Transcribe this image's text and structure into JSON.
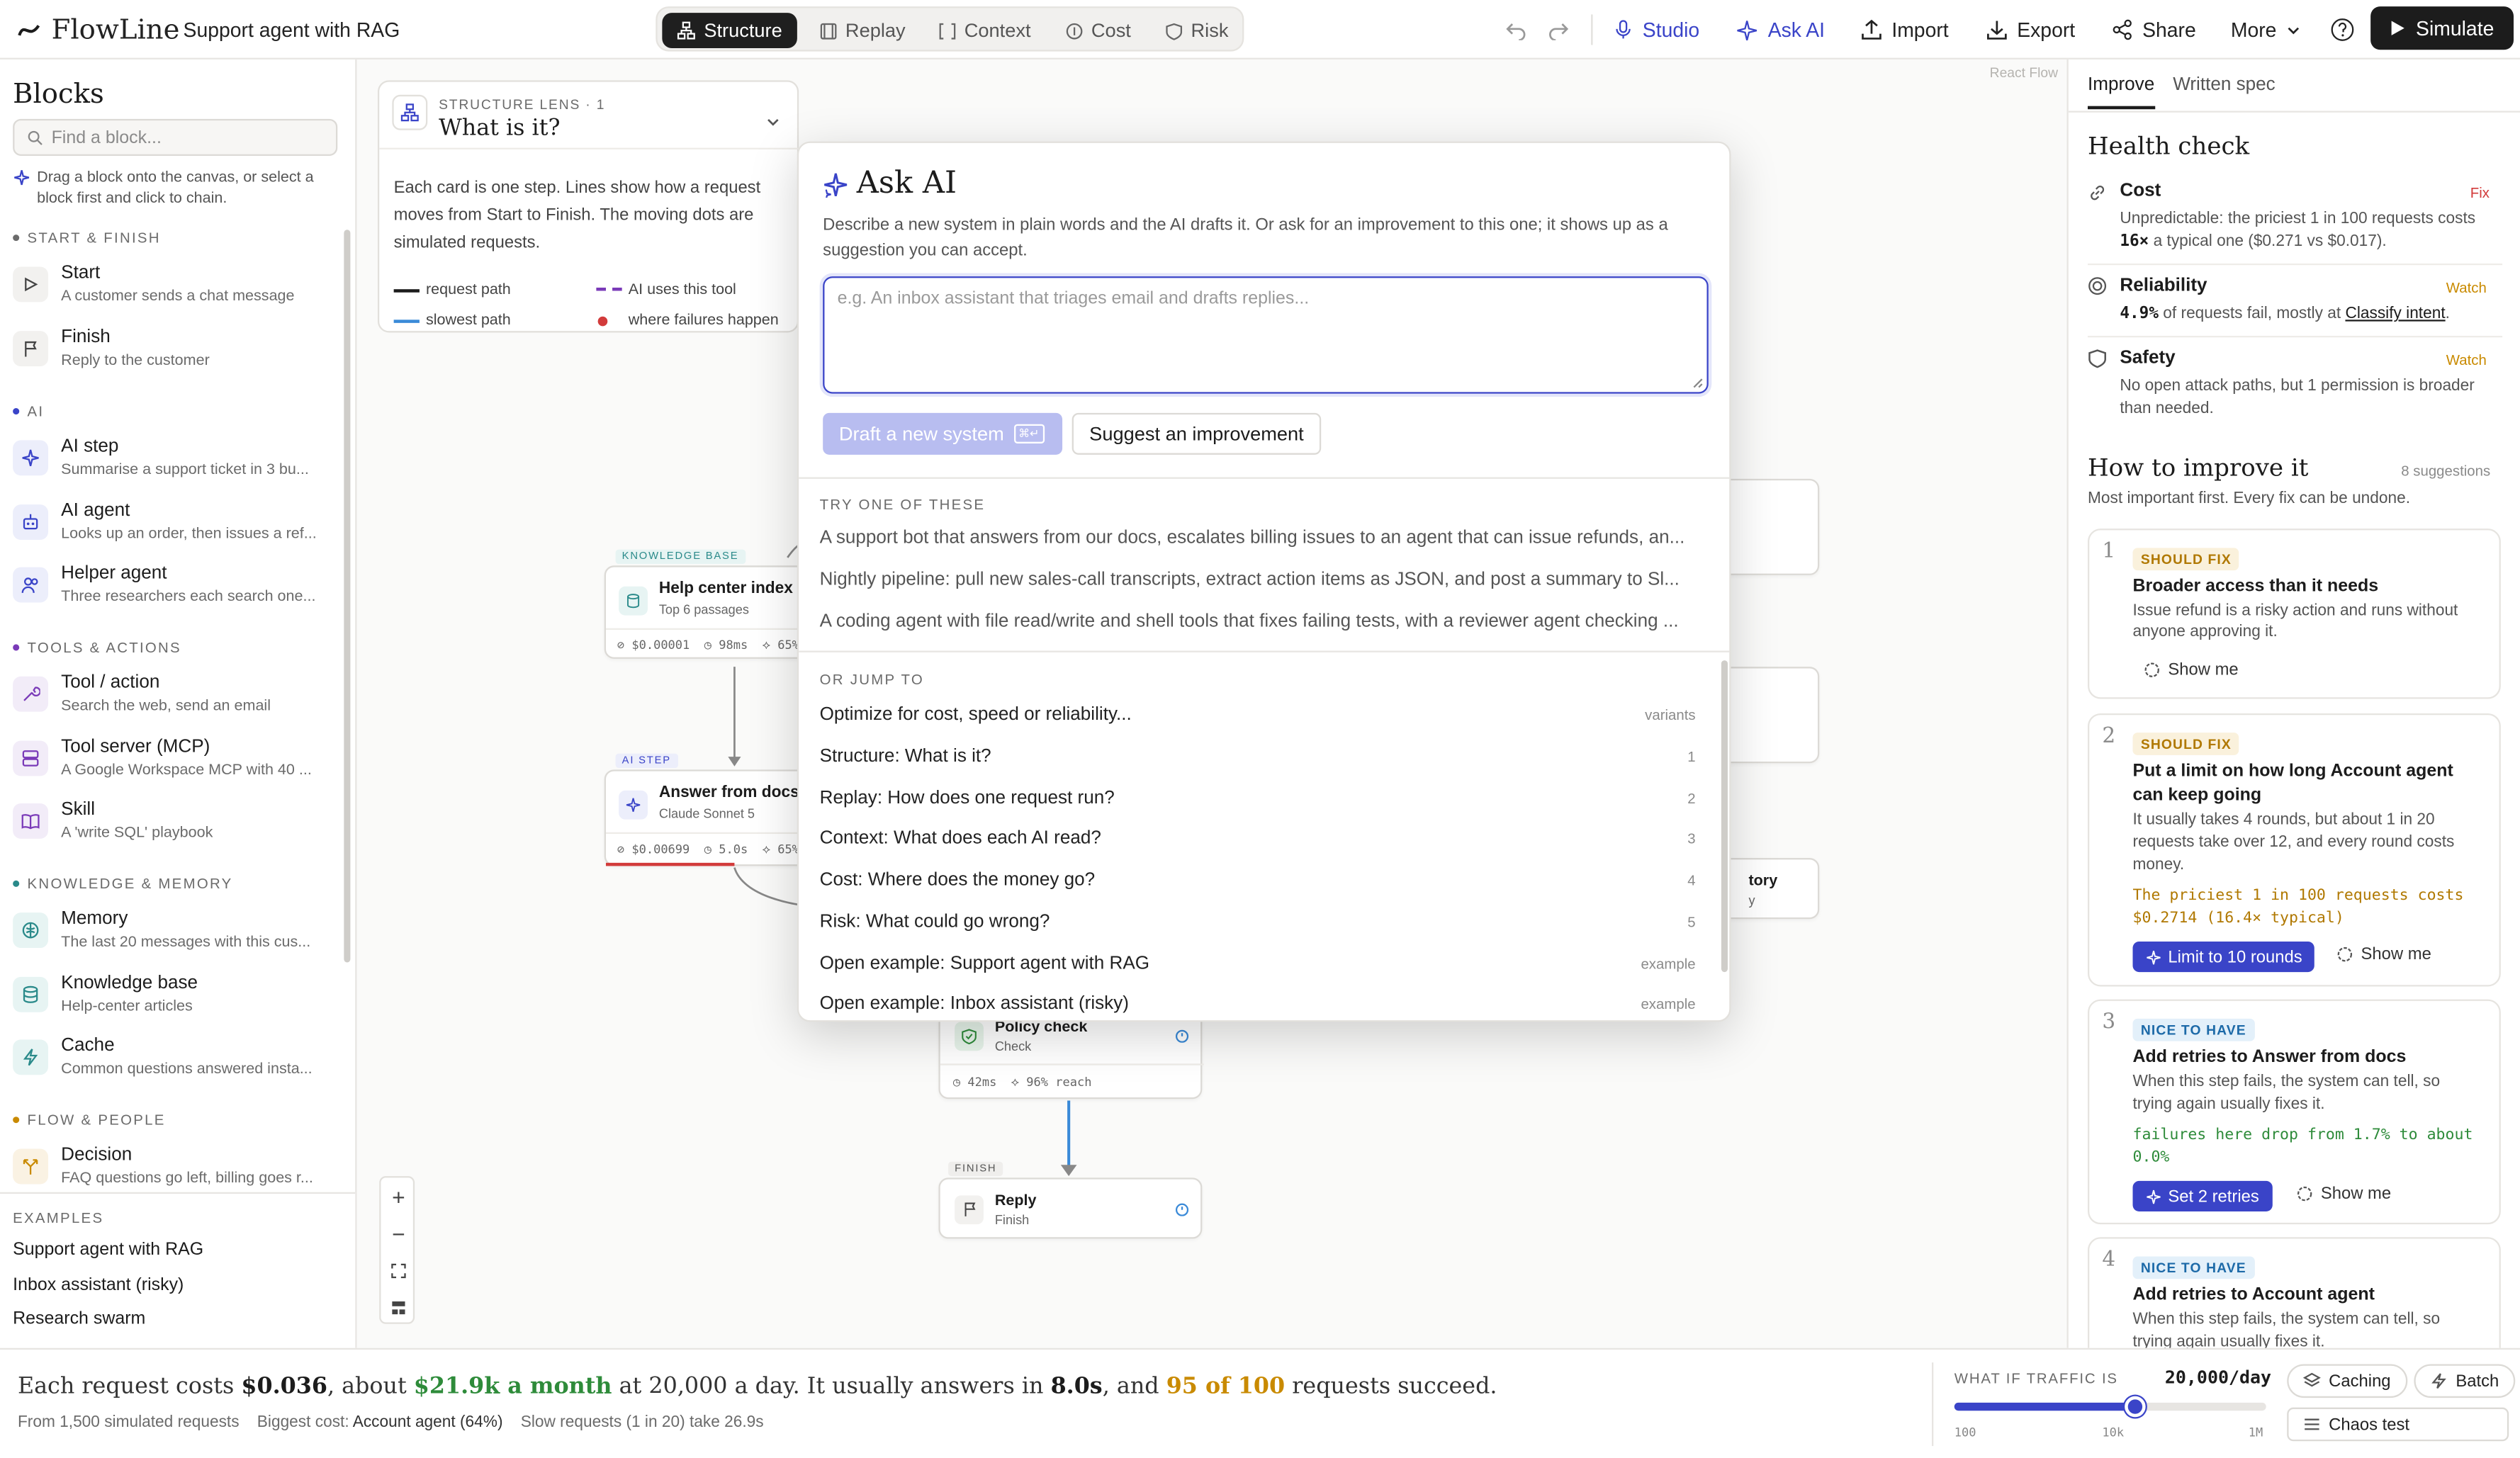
{
  "app": {
    "logo": "FlowLine",
    "project": "Support agent with RAG",
    "watermark": "React Flow"
  },
  "tabs": [
    "Structure",
    "Replay",
    "Context",
    "Cost",
    "Risk"
  ],
  "toolbar": {
    "studio": "Studio",
    "ask_ai": "Ask AI",
    "import": "Import",
    "export": "Export",
    "share": "Share",
    "more": "More",
    "simulate": "Simulate"
  },
  "left": {
    "title": "Blocks",
    "search_placeholder": "Find a block...",
    "hint": "Drag a block onto the canvas, or select a block first and click to chain.",
    "sections": {
      "start": "START & FINISH",
      "ai": "AI",
      "tools": "TOOLS & ACTIONS",
      "knowledge": "KNOWLEDGE & MEMORY",
      "flow": "FLOW & PEOPLE"
    },
    "blocks": [
      {
        "t": "Start",
        "s": "A customer sends a chat message"
      },
      {
        "t": "Finish",
        "s": "Reply to the customer"
      },
      {
        "t": "AI step",
        "s": "Summarise a support ticket in 3 bu..."
      },
      {
        "t": "AI agent",
        "s": "Looks up an order, then issues a ref..."
      },
      {
        "t": "Helper agent",
        "s": "Three researchers each search one..."
      },
      {
        "t": "Tool / action",
        "s": "Search the web, send an email"
      },
      {
        "t": "Tool server (MCP)",
        "s": "A Google Workspace MCP with 40 ..."
      },
      {
        "t": "Skill",
        "s": "A 'write SQL' playbook"
      },
      {
        "t": "Memory",
        "s": "The last 20 messages with this cus..."
      },
      {
        "t": "Knowledge base",
        "s": "Help-center articles"
      },
      {
        "t": "Cache",
        "s": "Common questions answered insta..."
      },
      {
        "t": "Decision",
        "s": "FAQ questions go left, billing goes r..."
      }
    ],
    "examples_title": "EXAMPLES",
    "examples": [
      "Support agent with RAG",
      "Inbox assistant (risky)",
      "Research swarm"
    ]
  },
  "lens": {
    "kicker": "STRUCTURE LENS · 1",
    "title": "What is it?",
    "desc": "Each card is one step. Lines show how a request moves from Start to Finish. The moving dots are simulated requests.",
    "legend": [
      "request path",
      "AI uses this tool",
      "slowest path",
      "where failures happen"
    ]
  },
  "nodes": {
    "kb": {
      "tag": "KNOWLEDGE BASE",
      "title": "Help center index",
      "sub": "Top 6 passages",
      "cost": "$0.00001",
      "lat": "98ms",
      "reach": "65%"
    },
    "ai": {
      "tag": "AI STEP",
      "title": "Answer from docs",
      "sub": "Claude Sonnet 5",
      "cost": "$0.00699",
      "lat": "5.0s",
      "reach": "65%"
    },
    "policy": {
      "title": "Policy check",
      "sub": "Check",
      "lat": "42ms",
      "reach": "96% reach"
    },
    "finish": {
      "tag": "FINISH",
      "title": "Reply",
      "sub": "Finish"
    },
    "hist": {
      "title": "tory",
      "sub": "y"
    }
  },
  "modal": {
    "title": "Ask AI",
    "desc": "Describe a new system in plain words and the AI drafts it. Or ask for an improvement to this one; it shows up as a suggestion you can accept.",
    "placeholder": "e.g. An inbox assistant that triages email and drafts replies...",
    "draft": "Draft a new system",
    "kbd": "⌘↵",
    "suggest": "Suggest an improvement",
    "try_title": "TRY ONE OF THESE",
    "try": [
      "A support bot that answers from our docs, escalates billing issues to an agent that can issue refunds, an...",
      "Nightly pipeline: pull new sales-call transcripts, extract action items as JSON, and post a summary to Sl...",
      "A coding agent with file read/write and shell tools that fixes failing tests, with a reviewer agent checking ..."
    ],
    "jump_title": "OR JUMP TO",
    "jump": [
      {
        "l": "Optimize for cost, speed or reliability...",
        "k": "variants"
      },
      {
        "l": "Structure: What is it?",
        "k": "1"
      },
      {
        "l": "Replay: How does one request run?",
        "k": "2"
      },
      {
        "l": "Context: What does each AI read?",
        "k": "3"
      },
      {
        "l": "Cost: Where does the money go?",
        "k": "4"
      },
      {
        "l": "Risk: What could go wrong?",
        "k": "5"
      },
      {
        "l": "Open example: Support agent with RAG",
        "k": "example"
      },
      {
        "l": "Open example: Inbox assistant (risky)",
        "k": "example"
      }
    ]
  },
  "right": {
    "tabs": [
      "Improve",
      "Written spec"
    ],
    "health_title": "Health check",
    "health": [
      {
        "t": "Cost",
        "status": "Fix",
        "d1": "Unpredictable: the priciest 1 in 100 requests costs",
        "d2a": "16×",
        "d2b": " a typical one ($0.271 vs $0.017)."
      },
      {
        "t": "Reliability",
        "status": "Watch",
        "d1a": "4.9%",
        "d1b": " of requests fail, mostly at ",
        "d1c": "Classify intent",
        "d1d": "."
      },
      {
        "t": "Safety",
        "status": "Watch",
        "d1": "No open attack paths, but 1 permission is broader",
        "d2": "than needed."
      }
    ],
    "improve_title": "How to improve it",
    "improve_count": "8 suggestions",
    "improve_sub": "Most important first. Every fix can be undone.",
    "cards": [
      {
        "n": "1",
        "badge": "SHOULD FIX",
        "t": "Broader access than it needs",
        "d": [
          "Issue refund is a risky action and runs without",
          "anyone approving it."
        ],
        "show": "Show me"
      },
      {
        "n": "2",
        "badge": "SHOULD FIX",
        "t": [
          "Put a limit on how long Account agent",
          "can keep going"
        ],
        "d": [
          "It usually takes 4 rounds, but about 1 in 20",
          "requests take over 12, and every round costs",
          "money."
        ],
        "mono": [
          "The priciest 1 in 100 requests costs",
          "$0.2714 (16.4× typical)"
        ],
        "btn": "Limit to 10 rounds",
        "show": "Show me"
      },
      {
        "n": "3",
        "badge": "NICE TO HAVE",
        "t": "Add retries to Answer from docs",
        "d": [
          "When this step fails, the system can tell, so",
          "trying again usually fixes it."
        ],
        "mono": [
          "failures here drop from 1.7% to about",
          "0.0%"
        ],
        "btn": "Set 2 retries",
        "show": "Show me"
      },
      {
        "n": "4",
        "badge": "NICE TO HAVE",
        "t": "Add retries to Account agent",
        "d": [
          "When this step fails, the system can tell, so",
          "trying again usually fixes it."
        ]
      }
    ]
  },
  "bottom": {
    "s1": "Each request costs ",
    "cost": "$0.036",
    "s2": ", about ",
    "month": "$21.9k a month",
    "s3": " at 20,000 a day. It usually answers in ",
    "time": "8.0s",
    "s4": ", and ",
    "succ": "95 of 100",
    "s5": " requests succeed.",
    "sub1": "From 1,500 simulated requests",
    "sub2": "Biggest cost: ",
    "sub2b": "Account agent (64%)",
    "sub3": "Slow requests (1 in 20) take 26.9s",
    "traffic_label": "WHAT IF TRAFFIC IS",
    "traffic_value": "20,000/day",
    "ticks": [
      "100",
      "10k",
      "1M"
    ],
    "caching": "Caching",
    "batch": "Batch",
    "chaos": "Chaos test"
  },
  "colors": {
    "accent": "#3a44c8",
    "amber": "#c98a00",
    "green": "#2e8b3a",
    "fix": "#d23b3b"
  }
}
